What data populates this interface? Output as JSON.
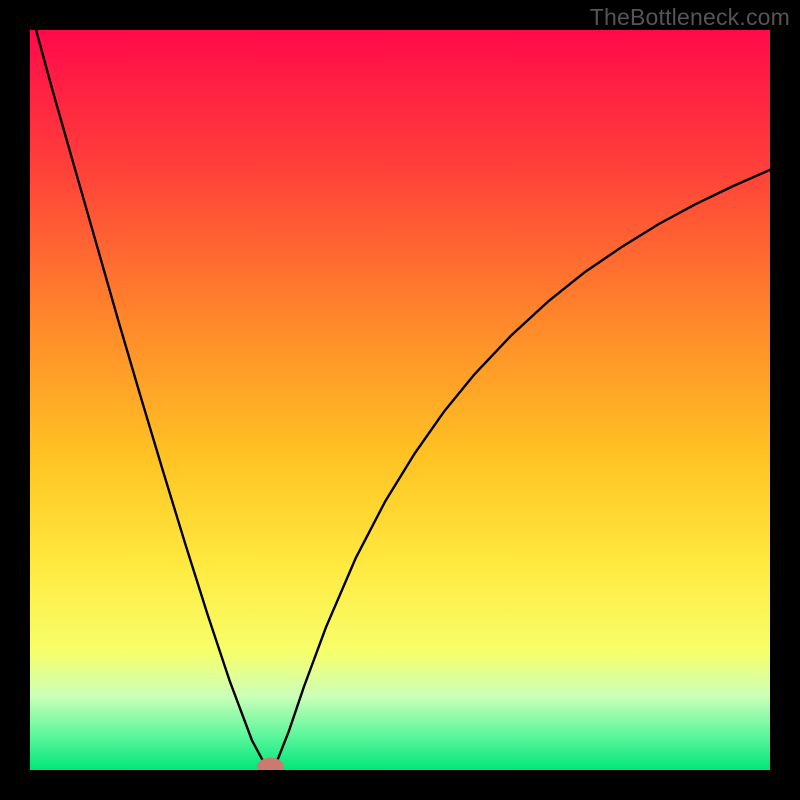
{
  "watermark": {
    "text": "TheBottleneck.com"
  },
  "chart_data": {
    "type": "line",
    "title": "",
    "xlabel": "",
    "ylabel": "",
    "xlim": [
      0,
      100
    ],
    "ylim": [
      0,
      100
    ],
    "grid": false,
    "axes_visible": false,
    "background_gradient": {
      "stops": [
        {
          "offset": 0.0,
          "color": "#ff0a4a"
        },
        {
          "offset": 0.18,
          "color": "#ff3e3a"
        },
        {
          "offset": 0.4,
          "color": "#ff8a2a"
        },
        {
          "offset": 0.58,
          "color": "#ffc423"
        },
        {
          "offset": 0.72,
          "color": "#ffe93f"
        },
        {
          "offset": 0.84,
          "color": "#f7ff6a"
        },
        {
          "offset": 0.9,
          "color": "#ccffb8"
        },
        {
          "offset": 0.95,
          "color": "#63f79e"
        },
        {
          "offset": 1.0,
          "color": "#00e777"
        }
      ]
    },
    "curve_left": {
      "x": [
        0,
        3,
        6,
        9,
        12,
        15,
        18,
        21,
        24,
        27,
        30,
        31.5,
        32.5
      ],
      "y": [
        103,
        92,
        81.5,
        71,
        60.5,
        50.3,
        40.3,
        30.5,
        21,
        12,
        4,
        1.2,
        0.2
      ]
    },
    "curve_right": {
      "x": [
        32.5,
        33.5,
        35,
        37,
        40,
        44,
        48,
        52,
        56,
        60,
        65,
        70,
        75,
        80,
        85,
        90,
        95,
        100
      ],
      "y": [
        0.2,
        1.5,
        5.3,
        11.2,
        19.3,
        28.6,
        36.3,
        42.8,
        48.5,
        53.4,
        58.7,
        63.3,
        67.3,
        70.7,
        73.8,
        76.5,
        78.9,
        81.1
      ]
    },
    "marker": {
      "x": 32.5,
      "y": 0.5,
      "color": "#cc7a70",
      "rx": 1.8,
      "ry": 1.15
    }
  }
}
